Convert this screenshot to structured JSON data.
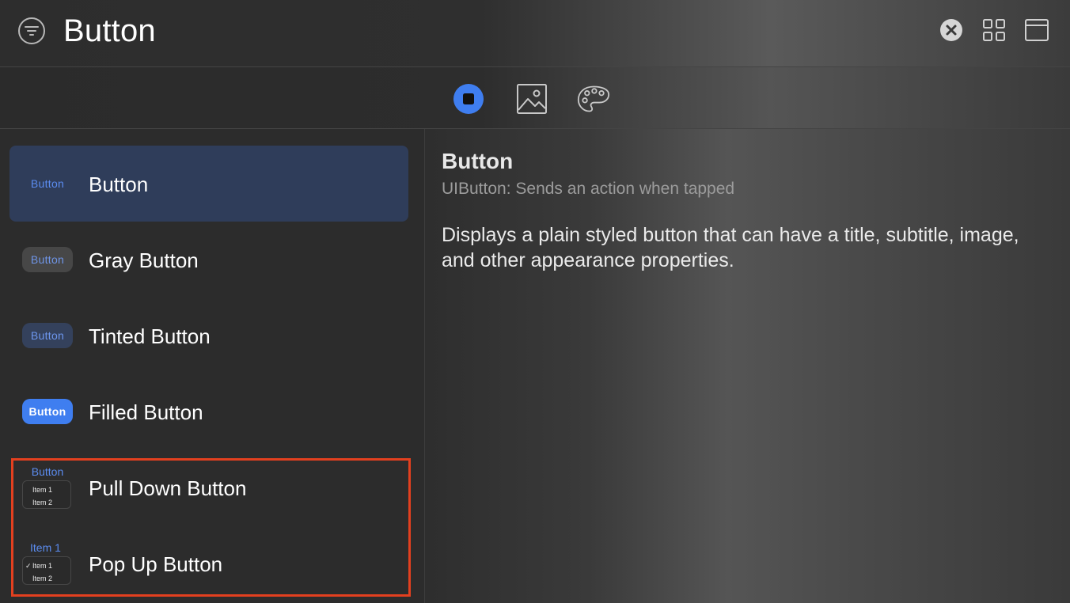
{
  "header": {
    "title": "Button",
    "filter_icon": "filter-icon",
    "right_icons": [
      "close-circle-icon",
      "grid-icon",
      "window-icon"
    ]
  },
  "toolbar": {
    "tabs": [
      {
        "icon": "stop-circle-icon",
        "active": true
      },
      {
        "icon": "image-icon",
        "active": false
      },
      {
        "icon": "palette-icon",
        "active": false
      }
    ],
    "accent": "#3f7ef0"
  },
  "sidebar": {
    "items": [
      {
        "label": "Button",
        "preview": "Button",
        "style": "plain",
        "selected": true
      },
      {
        "label": "Gray Button",
        "preview": "Button",
        "style": "gray"
      },
      {
        "label": "Tinted Button",
        "preview": "Button",
        "style": "tinted"
      },
      {
        "label": "Filled Button",
        "preview": "Button",
        "style": "filled"
      },
      {
        "label": "Pull Down Button",
        "preview_top": "Button",
        "menu_items": [
          "Item 1",
          "Item 2"
        ]
      },
      {
        "label": "Pop Up Button",
        "preview_top": "Item 1",
        "menu_items": [
          "Item 1",
          "Item 2"
        ],
        "checked": "✓"
      }
    ],
    "highlight_color": "#e3401f"
  },
  "detail": {
    "title": "Button",
    "subtitle": "UIButton: Sends an action when tapped",
    "description": "Displays a plain styled button that can have a title, subtitle, image, and other appearance properties."
  }
}
